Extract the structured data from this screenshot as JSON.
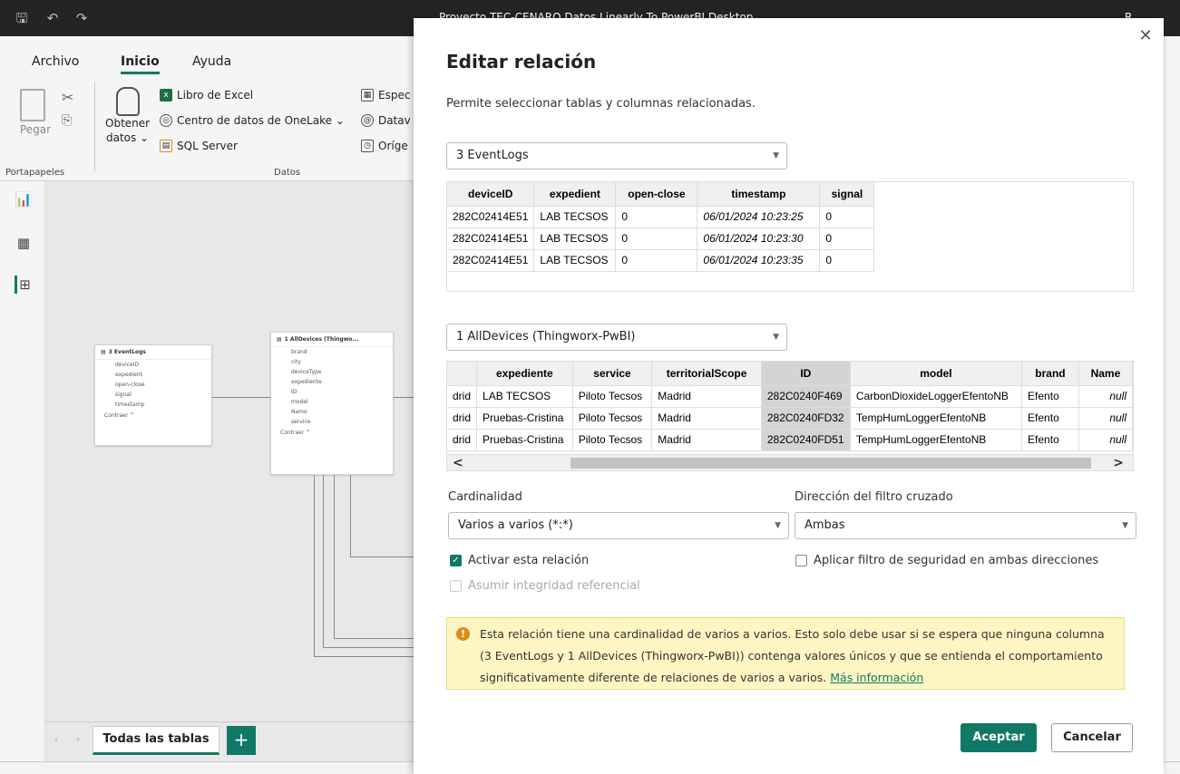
{
  "titlebar": {
    "title": "Proyecto TEC-CENARO Datos Linearly To PowerBI Desktop",
    "account": "R"
  },
  "ribbon": {
    "tabs": [
      {
        "label": "Archivo"
      },
      {
        "label": "Inicio"
      },
      {
        "label": "Ayuda"
      }
    ],
    "paste_label": "Pegar",
    "get_data_line1": "Obtener",
    "get_data_line2": "datos ⌄",
    "excel_label": "Libro de Excel",
    "onelake_label": "Centro de datos de OneLake ⌄",
    "sql_label": "SQL Server",
    "col3_1": "Espec",
    "col3_2": "Datav",
    "col3_3": "Oríge",
    "group_clipboard": "Portapapeles",
    "group_data": "Datos"
  },
  "canvas": {
    "card1": {
      "title": "3 EventLogs",
      "fields": [
        "deviceID",
        "expedient",
        "open-close",
        "signal",
        "timestamp"
      ],
      "footer": "Contraer ^"
    },
    "card2": {
      "title": "1 AllDevices (Thingwo...",
      "fields": [
        "brand",
        "city",
        "deviceType",
        "expediente",
        "ID",
        "model",
        "Name",
        "service"
      ],
      "footer": "Contraer ^"
    }
  },
  "bottombar": {
    "tab_label": "Todas las tablas",
    "add_label": "+"
  },
  "dialog": {
    "title": "Editar relación",
    "description": "Permite seleccionar tablas y columnas relacionadas.",
    "table1": {
      "selected": "3 EventLogs",
      "columns": [
        "deviceID",
        "expedient",
        "open-close",
        "timestamp",
        "signal"
      ],
      "rows": [
        [
          "282C02414E51",
          "LAB TECSOS",
          "0",
          "06/01/2024 10:23:25",
          "0"
        ],
        [
          "282C02414E51",
          "LAB TECSOS",
          "0",
          "06/01/2024 10:23:30",
          "0"
        ],
        [
          "282C02414E51",
          "LAB TECSOS",
          "0",
          "06/01/2024 10:23:35",
          "0"
        ]
      ]
    },
    "table2": {
      "selected": "1 AllDevices (Thingworx-PwBI)",
      "columns": [
        "",
        "expediente",
        "service",
        "territorialScope",
        "ID",
        "model",
        "brand",
        "Name"
      ],
      "rows": [
        [
          "drid",
          "LAB TECSOS",
          "Piloto Tecsos",
          "Madrid",
          "282C0240F469",
          "CarbonDioxideLoggerEfentoNB",
          "Efento",
          "null"
        ],
        [
          "drid",
          "Pruebas-Cristina",
          "Piloto Tecsos",
          "Madrid",
          "282C0240FD32",
          "TempHumLoggerEfentoNB",
          "Efento",
          "null"
        ],
        [
          "drid",
          "Pruebas-Cristina",
          "Piloto Tecsos",
          "Madrid",
          "282C0240FD51",
          "TempHumLoggerEfentoNB",
          "Efento",
          "null"
        ]
      ]
    },
    "cardinality_label": "Cardinalidad",
    "cardinality_value": "Varios a varios (*:*)",
    "filter_label": "Dirección del filtro cruzado",
    "filter_value": "Ambas",
    "activate_label": "Activar esta relación",
    "security_label": "Aplicar filtro de seguridad en ambas direcciones",
    "integrity_label": "Asumir integridad referencial",
    "warning_text": "Esta relación tiene una cardinalidad de varios a varios. Esto solo debe usar si se espera que ninguna columna (3 EventLogs y 1 AllDevices (Thingworx-PwBI)) contenga valores únicos y que se entienda el comportamiento significativamente diferente de relaciones de varios a varios.",
    "warning_link": "Más información",
    "ok_label": "Aceptar",
    "cancel_label": "Cancelar"
  },
  "colors": {
    "accent": "#117865",
    "warning_bg": "#fdf6c3",
    "titlebar": "#252423"
  }
}
